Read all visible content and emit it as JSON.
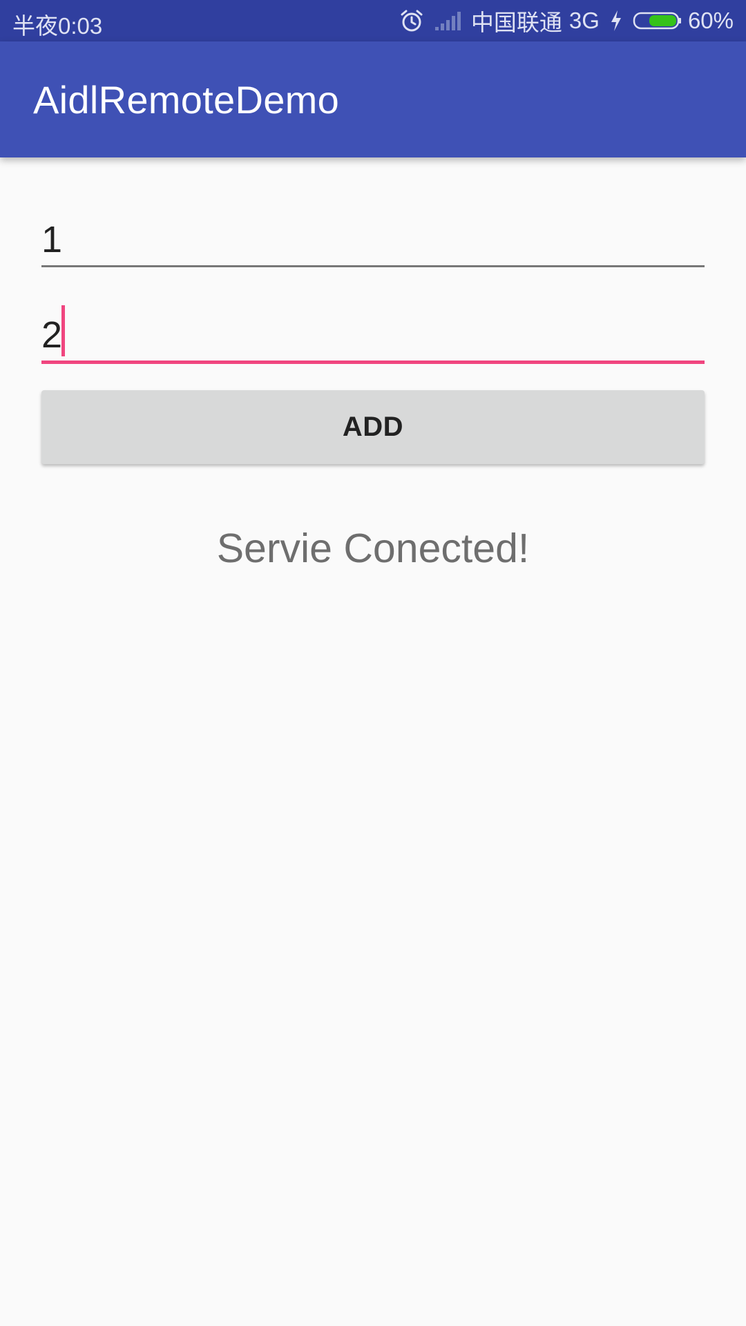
{
  "status_bar": {
    "time": "半夜0:03",
    "carrier": "中国联通",
    "network": "3G",
    "battery_percent": "60%",
    "icons": [
      "alarm-icon",
      "signal-icon",
      "charging-bolt-icon",
      "battery-icon"
    ],
    "battery_level": 0.6
  },
  "app_bar": {
    "title": "AidlRemoteDemo"
  },
  "form": {
    "first_input": {
      "value": "1"
    },
    "second_input": {
      "value": "2"
    },
    "add_button_label": "ADD"
  },
  "result": {
    "text": "Servie Conected!"
  },
  "colors": {
    "primary": "#3f51b5",
    "primary_dark": "#303f9f",
    "accent": "#f0457f",
    "background": "#fafafa"
  }
}
